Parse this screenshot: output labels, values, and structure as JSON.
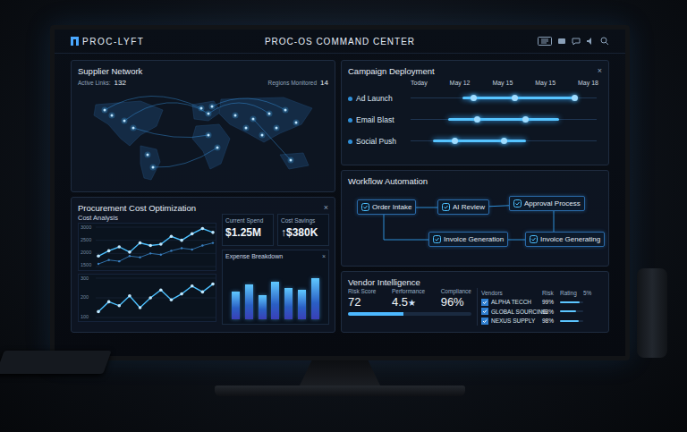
{
  "header": {
    "logo": "PROC-LYFT",
    "title": "PROC-OS COMMAND CENTER"
  },
  "supplier_network": {
    "title": "Supplier Network",
    "stats": [
      {
        "label": "Active Links:",
        "value": "132"
      },
      {
        "label": "Regions Monitored",
        "value": "14"
      }
    ]
  },
  "procurement": {
    "title": "Procurement Cost Optimization",
    "close": "×",
    "cost_analysis": {
      "title": "Cost Analysis",
      "charts": [
        {
          "ticks": [
            "3000",
            "2500",
            "2000",
            "1500"
          ],
          "series": [
            {
              "kind": "primary",
              "values": [
                1900,
                2100,
                2250,
                2050,
                2400,
                2300,
                2350,
                2650,
                2500,
                2750,
                2950,
                2800
              ]
            },
            {
              "kind": "secondary",
              "values": [
                1600,
                1750,
                1700,
                1900,
                1850,
                2000,
                1950,
                2100,
                2200,
                2150,
                2300,
                2400
              ]
            }
          ]
        },
        {
          "ticks": [
            "300",
            "200",
            "100"
          ],
          "series": [
            {
              "kind": "primary",
              "values": [
                130,
                180,
                160,
                210,
                150,
                200,
                240,
                190,
                220,
                260,
                230,
                270
              ]
            }
          ]
        }
      ]
    },
    "kpis": [
      {
        "label": "Current Spend",
        "value": "$1.25M"
      },
      {
        "label": "Cost Savings",
        "value": "↑$380K"
      }
    ],
    "expense": {
      "title": "Expense Breakdown",
      "close": "×",
      "values": [
        62,
        78,
        55,
        85,
        70,
        66,
        92
      ]
    }
  },
  "campaign": {
    "title": "Campaign Deployment",
    "close": "×",
    "ticks": [
      "Today",
      "May 12",
      "May 15",
      "May 15",
      "May 18"
    ],
    "rows": [
      {
        "label": "Ad Launch",
        "start": 0.28,
        "end": 0.88,
        "points": [
          0.34,
          0.56,
          0.88
        ]
      },
      {
        "label": "Email Blast",
        "start": 0.2,
        "end": 0.8,
        "points": [
          0.36,
          0.62
        ]
      },
      {
        "label": "Social Push",
        "start": 0.12,
        "end": 0.62,
        "points": [
          0.24,
          0.5
        ]
      }
    ]
  },
  "workflow": {
    "title": "Workflow Automation",
    "nodes": [
      {
        "label": "Order Intake"
      },
      {
        "label": "AI Review"
      },
      {
        "label": "Approval Process"
      },
      {
        "label": "Invoice Generation"
      },
      {
        "label": "Invoice Generating"
      }
    ]
  },
  "vendor": {
    "title": "Vendor Intelligence",
    "metrics": [
      {
        "label": "Risk Score",
        "value": "72",
        "icon": ""
      },
      {
        "label": "Performance",
        "value": "4.5",
        "icon": "★"
      },
      {
        "label": "Compliance",
        "value": "96%",
        "icon": ""
      }
    ],
    "level": 0.45,
    "columns": [
      "Vendors",
      "Risk",
      "Rating",
      "5%"
    ],
    "rows": [
      {
        "name": "ALPHA TECCH",
        "checked": true,
        "risk": "99%",
        "level": 0.85
      },
      {
        "name": "GLOBAL SOURCING",
        "checked": true,
        "risk": "93%",
        "level": 0.7
      },
      {
        "name": "NEXUS SUPPLY",
        "checked": true,
        "risk": "98%",
        "level": 0.8
      }
    ]
  }
}
